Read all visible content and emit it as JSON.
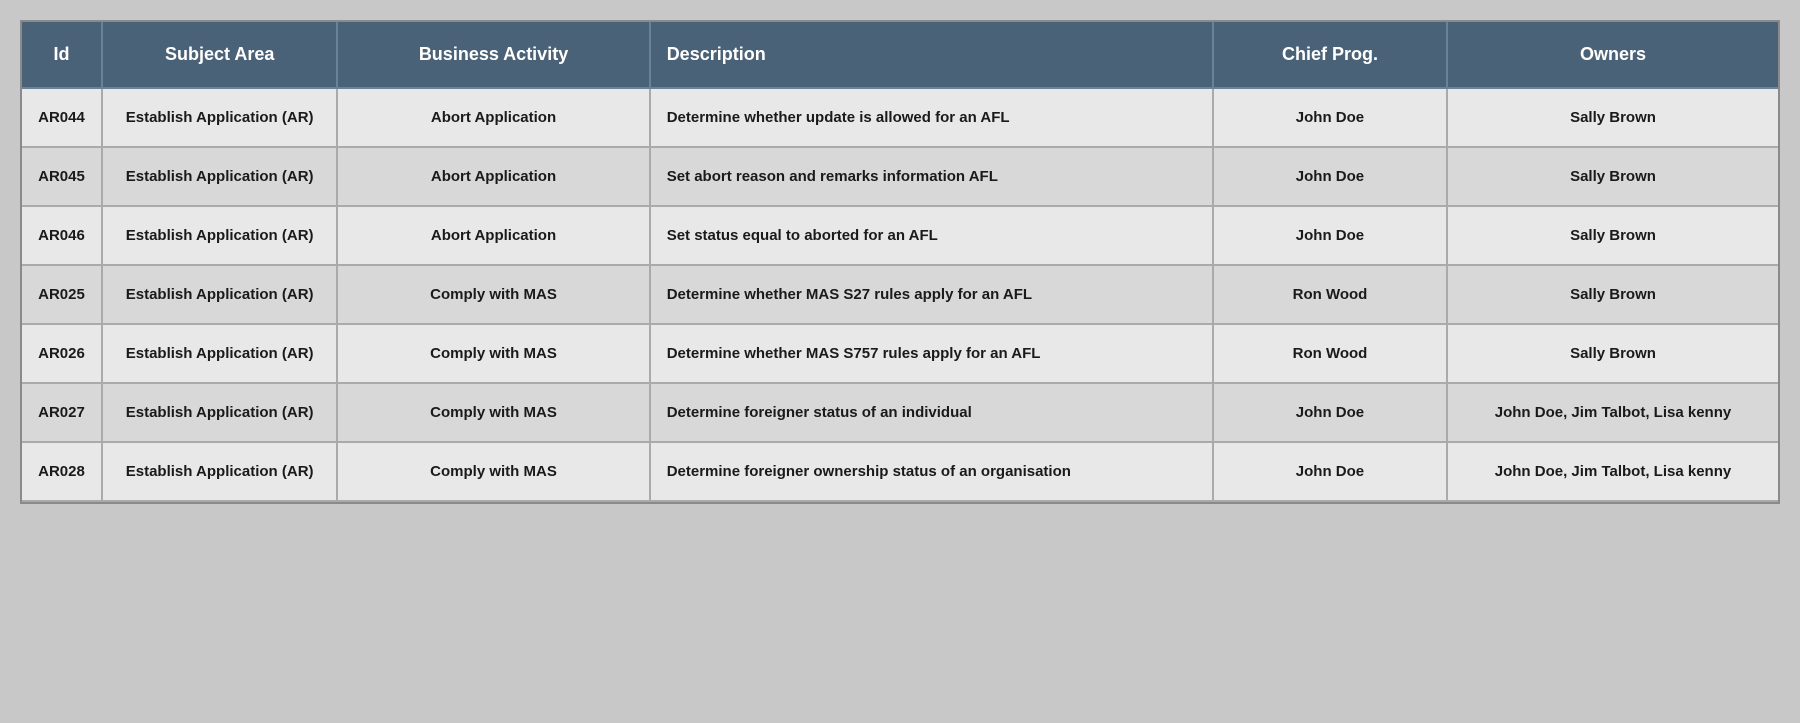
{
  "table": {
    "headers": {
      "id": "Id",
      "subject_area": "Subject Area",
      "business_activity": "Business Activity",
      "description": "Description",
      "chief_prog": "Chief Prog.",
      "owners": "Owners"
    },
    "rows": [
      {
        "id": "AR044",
        "subject_area": "Establish Application (AR)",
        "business_activity": "Abort Application",
        "description": "Determine whether update is allowed for an AFL",
        "chief_prog": "John Doe",
        "owners": "Sally Brown"
      },
      {
        "id": "AR045",
        "subject_area": "Establish Application (AR)",
        "business_activity": "Abort Application",
        "description": "Set abort reason and remarks information AFL",
        "chief_prog": "John Doe",
        "owners": "Sally Brown"
      },
      {
        "id": "AR046",
        "subject_area": "Establish Application (AR)",
        "business_activity": "Abort Application",
        "description": "Set status equal to aborted for an AFL",
        "chief_prog": "John Doe",
        "owners": "Sally Brown"
      },
      {
        "id": "AR025",
        "subject_area": "Establish Application (AR)",
        "business_activity": "Comply  with MAS",
        "description": "Determine whether MAS S27 rules apply for an AFL",
        "chief_prog": "Ron Wood",
        "owners": "Sally Brown"
      },
      {
        "id": "AR026",
        "subject_area": "Establish Application (AR)",
        "business_activity": "Comply  with MAS",
        "description": "Determine whether MAS S757 rules apply for an AFL",
        "chief_prog": "Ron Wood",
        "owners": "Sally Brown"
      },
      {
        "id": "AR027",
        "subject_area": "Establish Application (AR)",
        "business_activity": "Comply  with MAS",
        "description": "Determine foreigner status  of an individual",
        "chief_prog": "John Doe",
        "owners": "John Doe, Jim Talbot, Lisa kenny"
      },
      {
        "id": "AR028",
        "subject_area": "Establish Application (AR)",
        "business_activity": "Comply  with MAS",
        "description": "Determine foreigner ownership status of an organisation",
        "chief_prog": "John Doe",
        "owners": "John Doe, Jim Talbot, Lisa kenny"
      }
    ]
  }
}
